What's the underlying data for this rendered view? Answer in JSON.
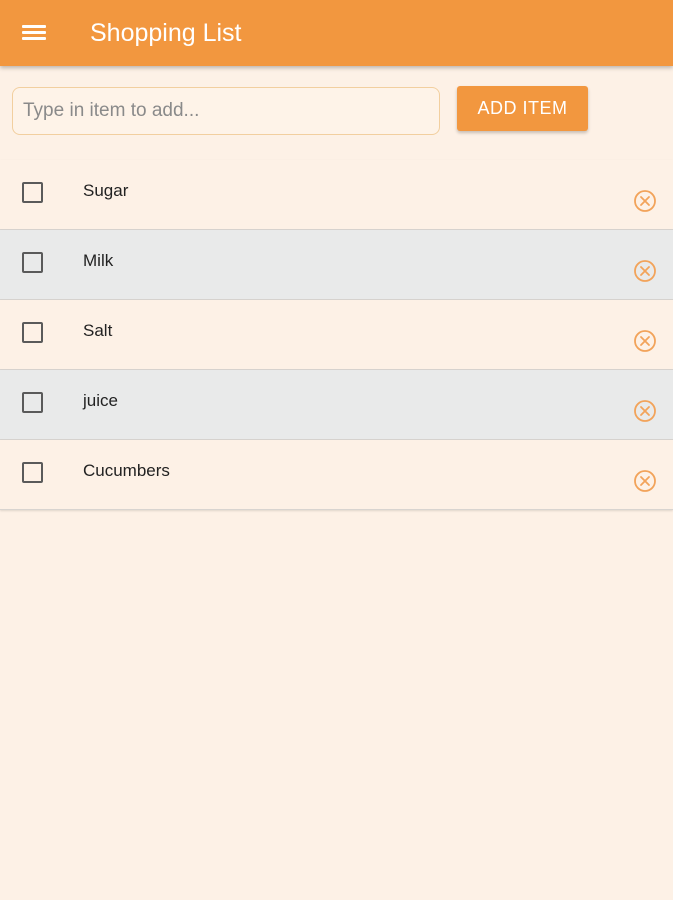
{
  "toolbar": {
    "menu_icon": "hamburger-menu-icon",
    "title": "Shopping List"
  },
  "add_form": {
    "placeholder": "Type in item to add...",
    "value": "",
    "button_label": "ADD ITEM"
  },
  "items": [
    {
      "label": "Sugar",
      "checked": false
    },
    {
      "label": "Milk",
      "checked": false
    },
    {
      "label": "Salt",
      "checked": false
    },
    {
      "label": "juice",
      "checked": false
    },
    {
      "label": "Cucumbers",
      "checked": false
    }
  ],
  "icons": {
    "remove": "close-circle-icon",
    "checkbox": "checkbox-unchecked"
  },
  "colors": {
    "accent": "#f2973f",
    "background": "#fdf1e6",
    "alt_row": "#e9eaea",
    "input_border": "#f2cf9f"
  }
}
